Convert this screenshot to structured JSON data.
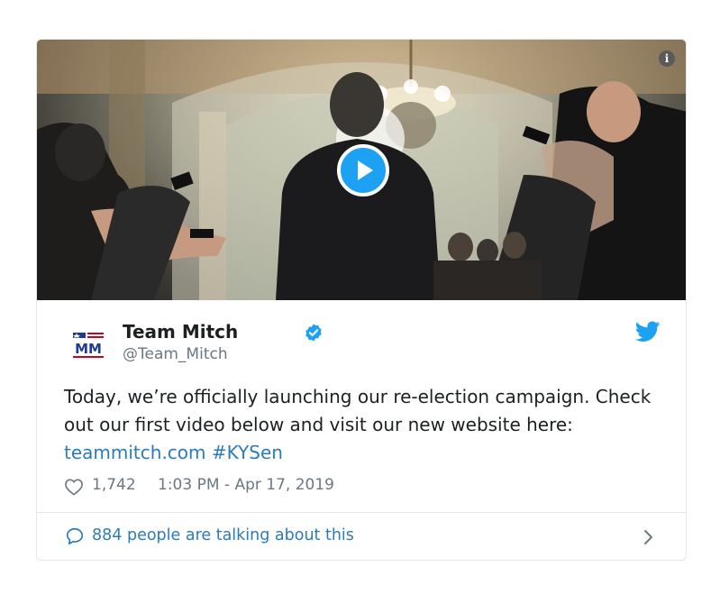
{
  "tweet": {
    "author": {
      "display_name": "Team Mitch",
      "handle": "@Team_Mitch",
      "verified": true,
      "avatar_text": "MM"
    },
    "text_parts": [
      "Today, we’re officially launching our re-election campaign. Check out our first video below and visit our new website here: ",
      "teammitch.com",
      " ",
      "#KYSen"
    ],
    "likes": "1,742",
    "timestamp": "1:03 PM - Apr 17, 2019",
    "talking": "884 people are talking about this"
  },
  "media": {
    "type": "video",
    "play_icon": "play-icon",
    "info_icon_glyph": "i"
  },
  "colors": {
    "accent": "#1da1f2",
    "link": "#2b7bb9",
    "text": "#1c2022",
    "muted": "#697882",
    "border": "#e1e8ed"
  },
  "icons": {
    "verified": "verified-badge-icon",
    "twitter": "twitter-bird-icon",
    "heart": "heart-icon",
    "bubble": "speech-bubble-icon",
    "chevron": "chevron-right-icon"
  }
}
